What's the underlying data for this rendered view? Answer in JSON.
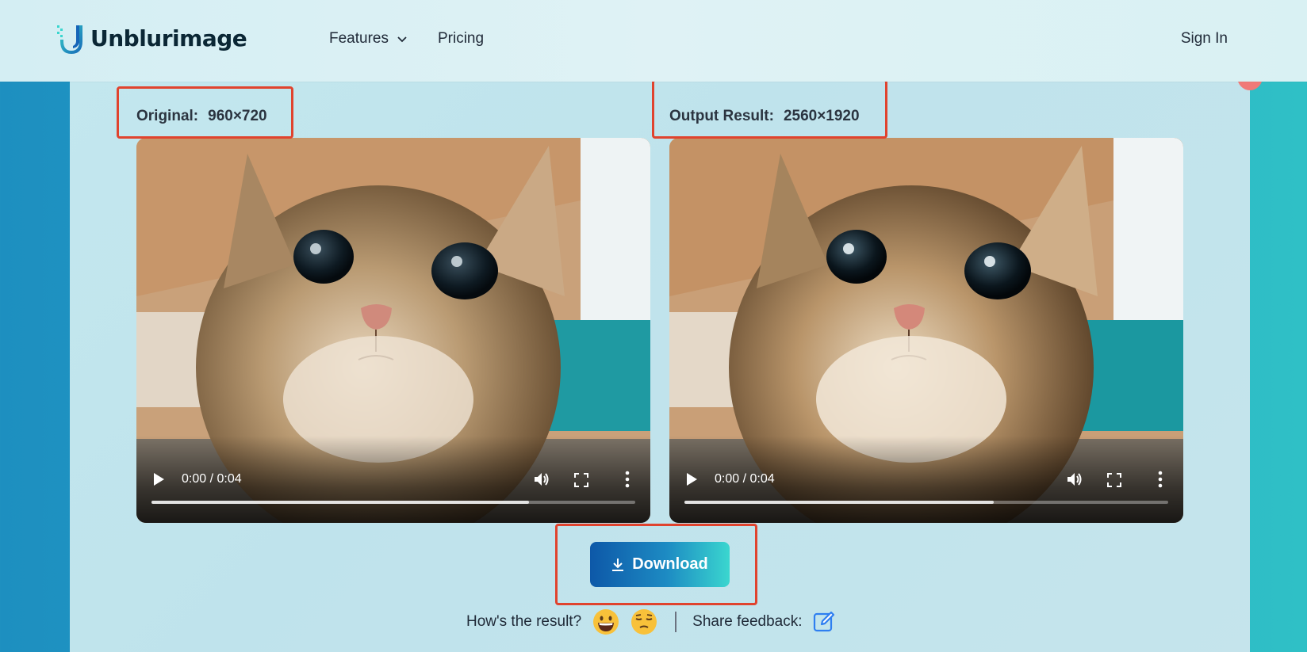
{
  "header": {
    "logo_text": "Unblurimage",
    "nav": [
      {
        "label": "Features",
        "has_dropdown": true
      },
      {
        "label": "Pricing"
      }
    ],
    "signin_label": "Sign In"
  },
  "original": {
    "label": "Original:",
    "dimensions": "960×720",
    "video_time": "0:00 / 0:04",
    "progress": 0.78
  },
  "output": {
    "label": "Output Result:",
    "dimensions": "2560×1920",
    "video_time": "0:00 / 0:04",
    "progress": 0.64
  },
  "download_label": "Download",
  "feedback": {
    "question": "How's the result?",
    "share_label": "Share feedback:",
    "icons": [
      "grinning-face-icon",
      "pensive-face-icon",
      "edit-icon"
    ]
  },
  "colors": {
    "highlight": "#e0432e",
    "brand_dark": "#0d58a8",
    "brand_light": "#3ad6cf"
  }
}
